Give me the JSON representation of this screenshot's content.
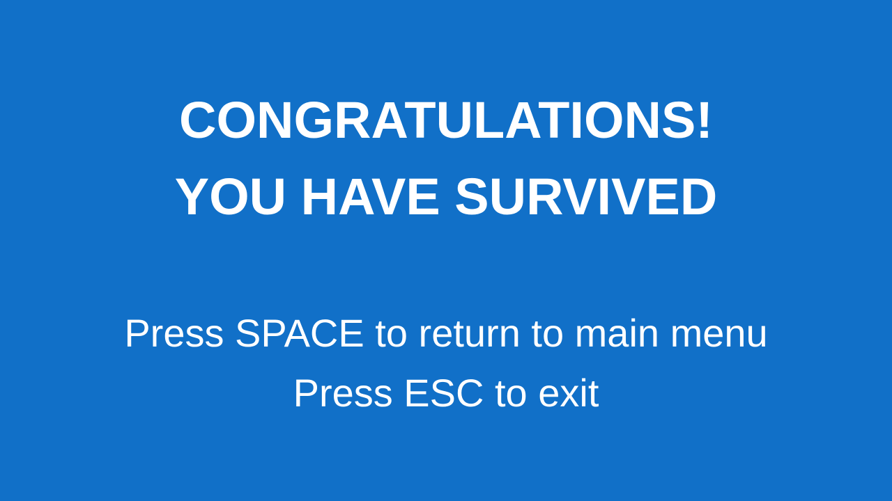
{
  "screen": {
    "background_color": "#1170c8",
    "text_color": "#ffffff"
  },
  "heading": {
    "line1": "CONGRATULATIONS!",
    "line2": "YOU HAVE SURVIVED"
  },
  "instructions": {
    "space": "Press SPACE to return to main menu",
    "esc": "Press ESC to exit"
  }
}
